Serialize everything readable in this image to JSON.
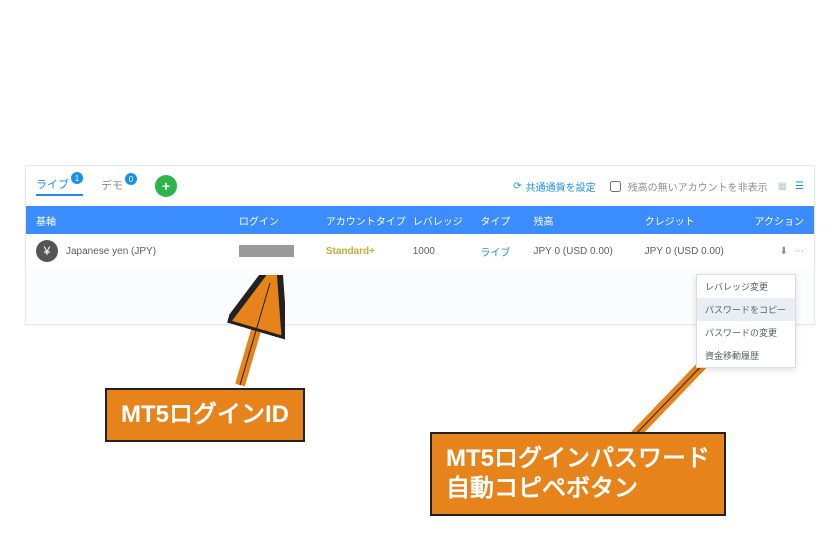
{
  "toolbar": {
    "tab_live": "ライブ",
    "tab_demo": "デモ",
    "badge_live": "1",
    "badge_demo": "0",
    "refresh_label": "共通通貨を設定",
    "hide_empty_label": "残高の無いアカウントを非表示"
  },
  "headers": {
    "currency": "基軸",
    "login": "ログイン",
    "account_type": "アカウントタイプ",
    "leverage": "レバレッジ",
    "category": "タイプ",
    "balance": "残高",
    "credit": "クレジット",
    "action": "アクション"
  },
  "row": {
    "currency_symbol": "¥",
    "currency_name": "Japanese yen (JPY)",
    "account_type": "Standard+",
    "leverage": "1000",
    "category": "ライブ",
    "balance": "JPY 0 (USD 0.00)",
    "credit": "JPY 0 (USD 0.00)"
  },
  "dropdown": {
    "item1": "レバレッジ変更",
    "item2": "パスワードをコピー",
    "item3": "パスワードの変更",
    "item4": "資金移動履歴"
  },
  "annotations": {
    "login_id": "MT5ログインID",
    "password_copy": "MT5ログインパスワード\n自動コピペボタン"
  }
}
